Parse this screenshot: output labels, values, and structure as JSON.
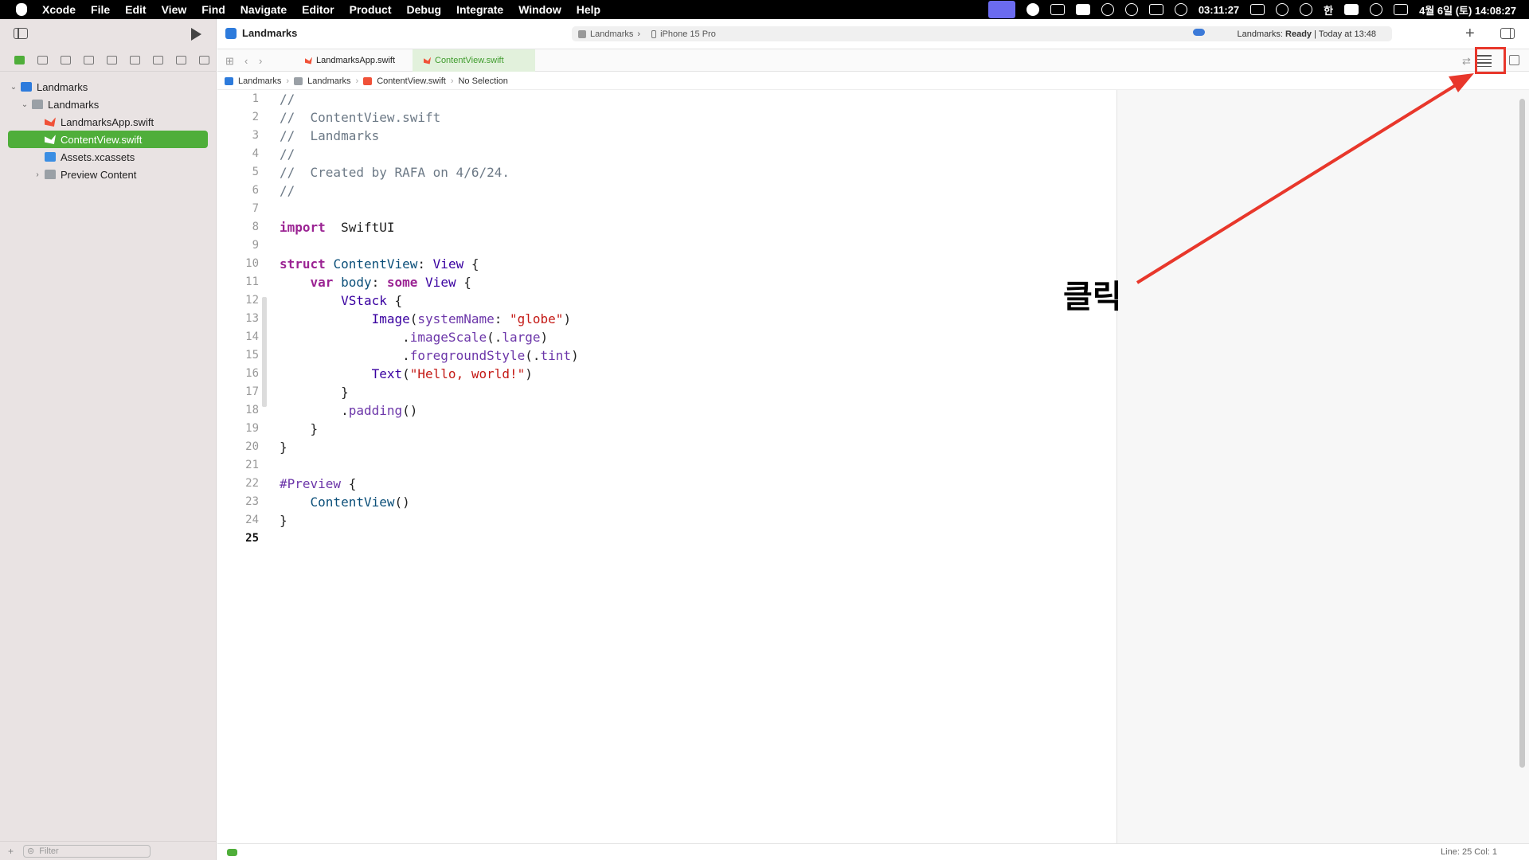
{
  "menubar": {
    "app": "Xcode",
    "items": [
      "File",
      "Edit",
      "View",
      "Find",
      "Navigate",
      "Editor",
      "Product",
      "Debug",
      "Integrate",
      "Window",
      "Help"
    ],
    "clock_timer": "03:11:27",
    "input_lang": "한",
    "datetime": "4월 6일 (토) 14:08:27"
  },
  "toolbar": {
    "project_title": "Landmarks",
    "scheme": "Landmarks",
    "destination": "iPhone 15 Pro",
    "status_prefix": "Landmarks: ",
    "status_state": "Ready",
    "status_time": " | Today at 13:48"
  },
  "navigator": {
    "items": [
      {
        "label": "Landmarks",
        "icon": "project-icon"
      },
      {
        "label": "Landmarks",
        "icon": "folder-icon"
      },
      {
        "label": "LandmarksApp.swift",
        "icon": "swift-file-icon"
      },
      {
        "label": "ContentView.swift",
        "icon": "swift-file-icon",
        "selected": true
      },
      {
        "label": "Assets.xcassets",
        "icon": "asset-catalog-icon"
      },
      {
        "label": "Preview Content",
        "icon": "folder-icon"
      }
    ],
    "filter_placeholder": "Filter"
  },
  "tabs": [
    {
      "label": "LandmarksApp.swift",
      "active": false
    },
    {
      "label": "ContentView.swift",
      "active": true
    }
  ],
  "breadcrumb": [
    "Landmarks",
    "Landmarks",
    "ContentView.swift",
    "No Selection"
  ],
  "editor": {
    "line_numbers": [
      "1",
      "2",
      "3",
      "4",
      "5",
      "6",
      "7",
      "8",
      "9",
      "10",
      "11",
      "12",
      "13",
      "14",
      "15",
      "16",
      "17",
      "18",
      "19",
      "20",
      "21",
      "22",
      "23",
      "24",
      "25"
    ],
    "current_line": "25",
    "code": [
      [
        [
          "c",
          "//"
        ]
      ],
      [
        [
          "c",
          "//  ContentView.swift"
        ]
      ],
      [
        [
          "c",
          "//  Landmarks"
        ]
      ],
      [
        [
          "c",
          "//"
        ]
      ],
      [
        [
          "c",
          "//  Created by RAFA on 4/6/24."
        ]
      ],
      [
        [
          "c",
          "//"
        ]
      ],
      [],
      [
        [
          "k",
          "import"
        ],
        [
          "",
          "  SwiftUI"
        ]
      ],
      [],
      [
        [
          "k",
          "struct"
        ],
        [
          "",
          " "
        ],
        [
          "t",
          "ContentView"
        ],
        [
          "",
          ": "
        ],
        [
          "p",
          "View"
        ],
        [
          "",
          " {"
        ]
      ],
      [
        [
          "",
          "    "
        ],
        [
          "k",
          "var"
        ],
        [
          "",
          " "
        ],
        [
          "t",
          "body"
        ],
        [
          "",
          ": "
        ],
        [
          "k",
          "some"
        ],
        [
          "",
          " "
        ],
        [
          "p",
          "View"
        ],
        [
          "",
          " {"
        ]
      ],
      [
        [
          "",
          "        "
        ],
        [
          "p",
          "VStack"
        ],
        [
          "",
          " {"
        ]
      ],
      [
        [
          "",
          "            "
        ],
        [
          "p",
          "Image"
        ],
        [
          "",
          "("
        ],
        [
          "m",
          "systemName"
        ],
        [
          "",
          ": "
        ],
        [
          "s",
          "\"globe\""
        ],
        [
          "",
          ")"
        ]
      ],
      [
        [
          "",
          "                ."
        ],
        [
          "m",
          "imageScale"
        ],
        [
          "",
          "(."
        ],
        [
          "m",
          "large"
        ],
        [
          "",
          ")"
        ]
      ],
      [
        [
          "",
          "                ."
        ],
        [
          "m",
          "foregroundStyle"
        ],
        [
          "",
          "(."
        ],
        [
          "m",
          "tint"
        ],
        [
          "",
          ")"
        ]
      ],
      [
        [
          "",
          "            "
        ],
        [
          "p",
          "Text"
        ],
        [
          "",
          "("
        ],
        [
          "s",
          "\"Hello, world!\""
        ],
        [
          "",
          ")"
        ]
      ],
      [
        [
          "",
          "        }"
        ]
      ],
      [
        [
          "",
          "        ."
        ],
        [
          "m",
          "padding"
        ],
        [
          "",
          "()"
        ]
      ],
      [
        [
          "",
          "    }"
        ]
      ],
      [
        [
          "",
          "}"
        ]
      ],
      [],
      [
        [
          "m",
          "#Preview"
        ],
        [
          "",
          " {"
        ]
      ],
      [
        [
          "",
          "    "
        ],
        [
          "t",
          "ContentView"
        ],
        [
          "",
          "()"
        ]
      ],
      [
        [
          "",
          "}"
        ]
      ],
      []
    ]
  },
  "annotation": "클릭",
  "statusbar": {
    "position": "Line: 25  Col: 1"
  },
  "colors": {
    "accent_green": "#4fae3a",
    "highlight_red": "#e8372b"
  }
}
